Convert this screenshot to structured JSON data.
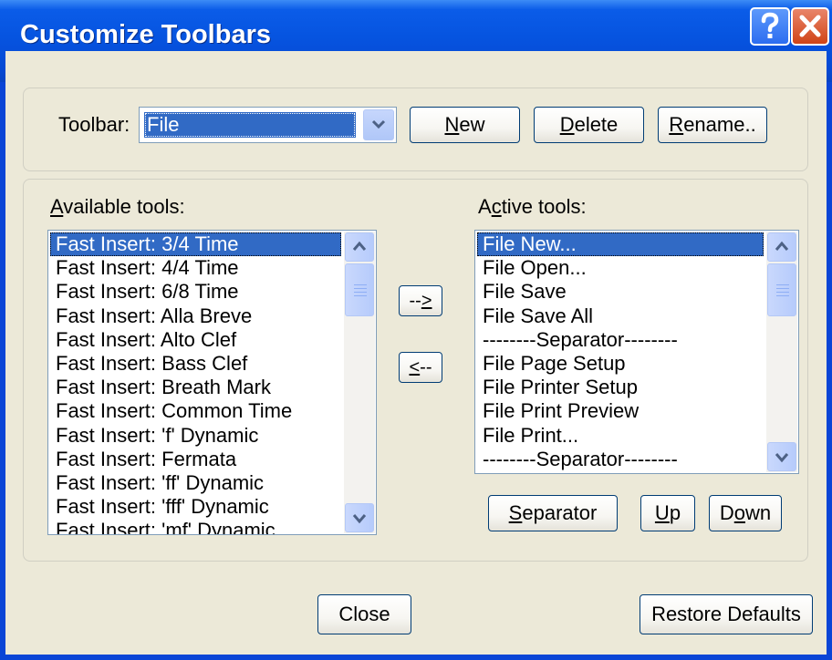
{
  "window": {
    "title": "Customize Toolbars"
  },
  "toolbar_row": {
    "label_prefix": "Toolbar:",
    "selected": "File",
    "new_button": {
      "mnemonic": "N",
      "rest": "ew"
    },
    "delete_button": {
      "mnemonic": "D",
      "rest": "elete"
    },
    "rename_button": {
      "mnemonic": "R",
      "rest": "ename.."
    }
  },
  "available": {
    "label_mnemonic": "A",
    "label_rest": "vailable tools:",
    "items": [
      "Fast Insert: 3/4 Time",
      "Fast Insert: 4/4 Time",
      "Fast Insert: 6/8 Time",
      "Fast Insert: Alla Breve",
      "Fast Insert: Alto Clef",
      "Fast Insert: Bass Clef",
      "Fast Insert: Breath Mark",
      "Fast Insert: Common Time",
      "Fast Insert: 'f' Dynamic",
      "Fast Insert: Fermata",
      "Fast Insert: 'ff' Dynamic",
      "Fast Insert: 'fff' Dynamic",
      "Fast Insert: 'mf' Dynamic"
    ],
    "selected_index": 0
  },
  "move_buttons": {
    "add": {
      "mnemonic": ">",
      "prefix": "--"
    },
    "remove": {
      "mnemonic": "<",
      "suffix": "--"
    }
  },
  "active": {
    "label_before": "A",
    "label_mnemonic": "c",
    "label_rest": "tive tools:",
    "items": [
      "File New...",
      "File Open...",
      "File Save",
      "File Save All",
      "--------Separator--------",
      "File Page Setup",
      "File Printer Setup",
      "File Print Preview",
      "File Print...",
      "--------Separator--------"
    ],
    "selected_index": 0
  },
  "active_buttons": {
    "separator": {
      "mnemonic": "S",
      "rest": "eparator"
    },
    "up": {
      "mnemonic": "U",
      "rest": "p"
    },
    "down": {
      "before": "D",
      "mnemonic": "o",
      "rest": "wn"
    }
  },
  "footer": {
    "close": "Close",
    "restore": "Restore Defaults"
  },
  "colors": {
    "selection": "#316ac5",
    "titlebar": "#0654e0",
    "dialog_bg": "#ece9d8"
  }
}
